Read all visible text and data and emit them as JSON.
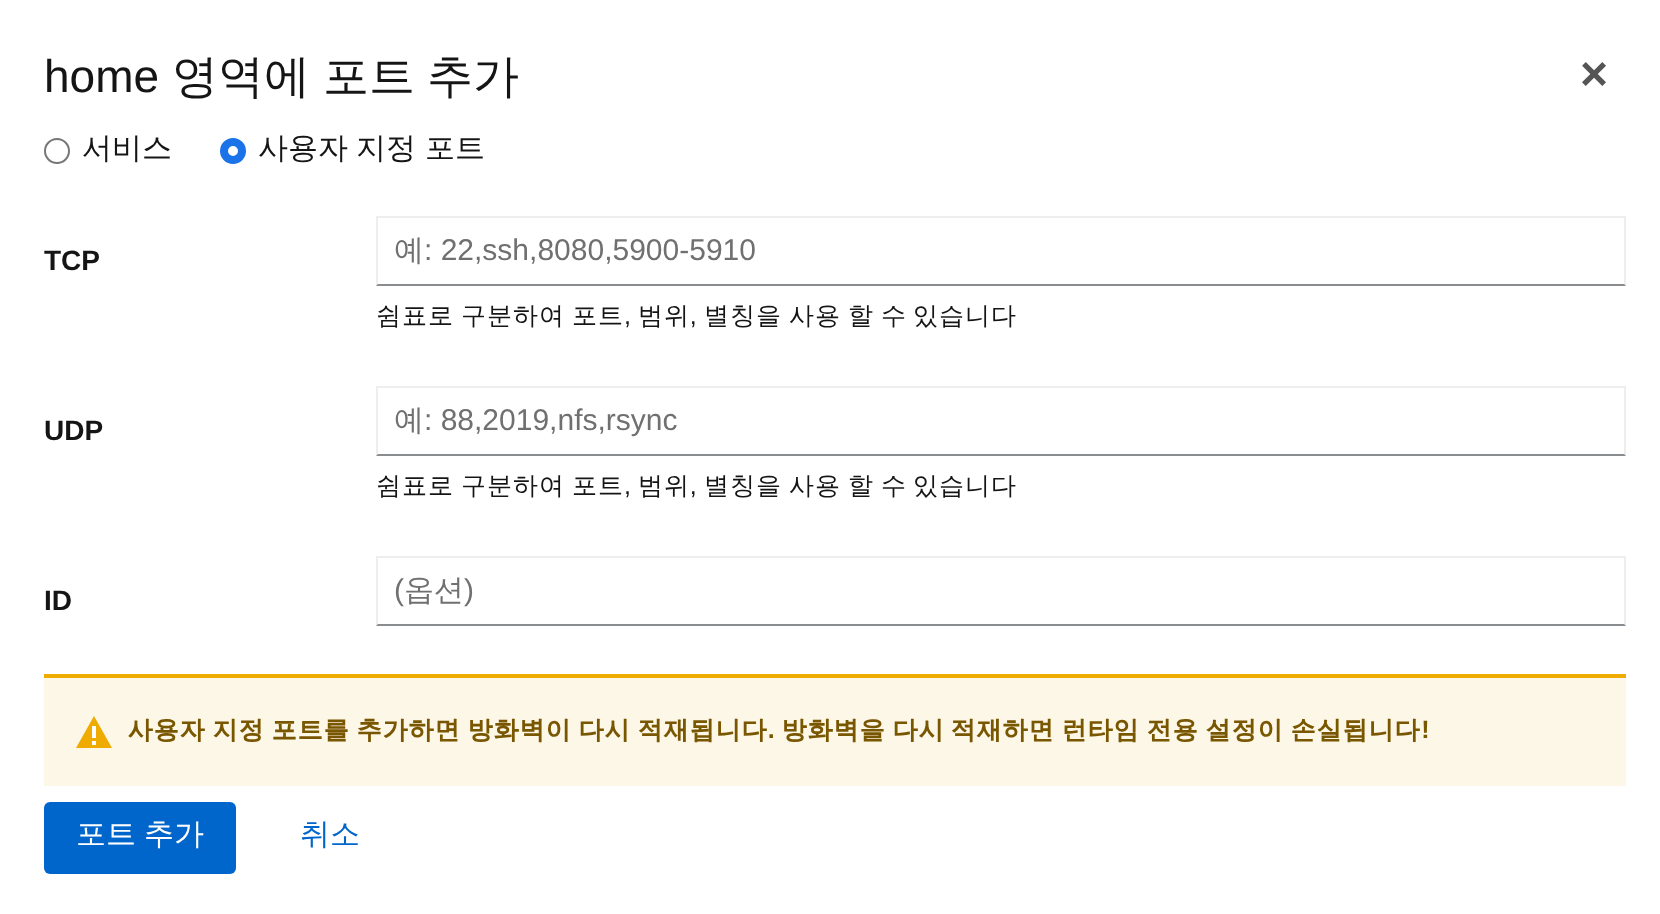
{
  "dialog": {
    "title": "home 영역에 포트 추가",
    "close": "×"
  },
  "mode_options": [
    {
      "label": "서비스",
      "selected": false
    },
    {
      "label": "사용자 지정 포트",
      "selected": true
    }
  ],
  "fields": [
    {
      "label": "TCP",
      "placeholder": "예: 22,ssh,8080,5900-5910",
      "help": "쉼표로 구분하여 포트, 범위, 별칭을 사용 할 수 있습니다"
    },
    {
      "label": "UDP",
      "placeholder": "예: 88,2019,nfs,rsync",
      "help": "쉼표로 구분하여 포트, 범위, 별칭을 사용 할 수 있습니다"
    },
    {
      "label": "ID",
      "placeholder": "(옵션)"
    }
  ],
  "warning": "사용자 지정 포트를 추가하면 방화벽이 다시 적재됩니다. 방화벽을 다시 적재하면 런타임 전용 설정이 손실됩니다!",
  "buttons": {
    "primary": "포트 추가",
    "cancel": "취소"
  }
}
